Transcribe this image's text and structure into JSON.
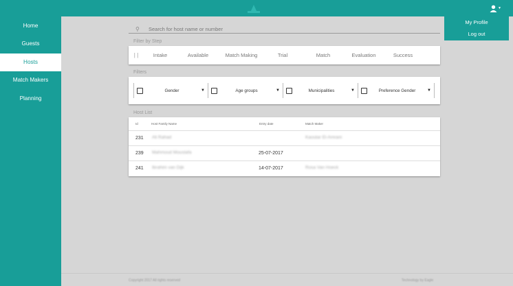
{
  "header": {
    "logo": "logo-icon",
    "user_menu_icon": "user-icon"
  },
  "sidebar": {
    "items": [
      {
        "label": "Home"
      },
      {
        "label": "Guests"
      },
      {
        "label": "Hosts"
      },
      {
        "label": "Match Makers"
      },
      {
        "label": "Planning"
      }
    ],
    "active": "Hosts"
  },
  "search": {
    "placeholder": "Search for host name or number"
  },
  "sections": {
    "filter_by_step": "Filter by Step",
    "filters": "Filters",
    "host_list": "Host List"
  },
  "steps": [
    "Intake",
    "Available",
    "Match Making",
    "Trial",
    "Match",
    "Evaluation",
    "Success"
  ],
  "filters": [
    {
      "label": "Gender"
    },
    {
      "label": "Age groups"
    },
    {
      "label": "Municipalities"
    },
    {
      "label": "Preference Gender"
    }
  ],
  "table": {
    "headers": [
      "Id",
      "Host Family Name",
      "Entry date",
      "Match Maker"
    ],
    "rows": [
      {
        "id": "231",
        "name": "Ali Rahad",
        "date": "",
        "match_maker": "Kaoutar El-Amrani"
      },
      {
        "id": "239",
        "name": "Mahmoud Moustafa",
        "date": "25-07-2017",
        "match_maker": ""
      },
      {
        "id": "241",
        "name": "Ibrahim van Dijk",
        "date": "14-07-2017",
        "match_maker": "Rosa Van Hoeck"
      }
    ]
  },
  "footer": {
    "left": "Copyright 2017 All rights reserved",
    "right": "Technology by Eagle"
  },
  "profile_menu": {
    "items": [
      "My Profile",
      "Log out"
    ]
  },
  "colors": {
    "accent": "#189e98",
    "background": "#d6d6d6"
  }
}
